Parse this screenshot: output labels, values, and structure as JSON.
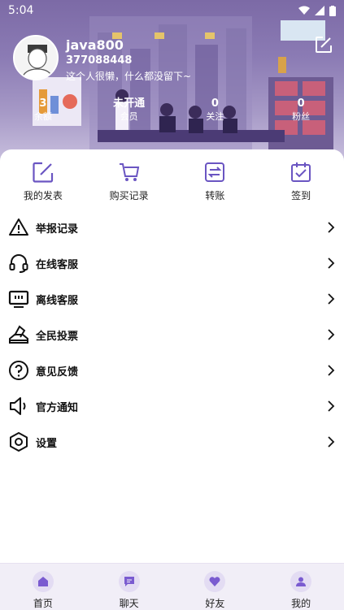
{
  "statusbar": {
    "time": "5:04"
  },
  "profile": {
    "name": "java800",
    "id": "377088448",
    "bio": "这个人很懒，什么都没留下~"
  },
  "stats": [
    {
      "value": "3",
      "label": "余额"
    },
    {
      "value": "未开通",
      "label": "会员"
    },
    {
      "value": "0",
      "label": "关注"
    },
    {
      "value": "0",
      "label": "粉丝"
    }
  ],
  "quick_actions": [
    {
      "label": "我的发表",
      "icon": "edit-square-icon"
    },
    {
      "label": "购买记录",
      "icon": "cart-icon"
    },
    {
      "label": "转账",
      "icon": "transfer-icon"
    },
    {
      "label": "签到",
      "icon": "checkin-icon"
    }
  ],
  "menu": [
    {
      "label": "举报记录",
      "icon": "warning-icon"
    },
    {
      "label": "在线客服",
      "icon": "headset-icon"
    },
    {
      "label": "离线客服",
      "icon": "monitor-icon"
    },
    {
      "label": "全民投票",
      "icon": "vote-icon"
    },
    {
      "label": "意见反馈",
      "icon": "question-icon"
    },
    {
      "label": "官方通知",
      "icon": "speaker-icon"
    },
    {
      "label": "设置",
      "icon": "settings-icon"
    }
  ],
  "tabs": [
    {
      "label": "首页",
      "icon": "home-icon"
    },
    {
      "label": "聊天",
      "icon": "chat-icon"
    },
    {
      "label": "好友",
      "icon": "heart-icon"
    },
    {
      "label": "我的",
      "icon": "user-icon"
    }
  ],
  "colors": {
    "accent": "#6a55c2",
    "header_bg": "#8b7bb4",
    "tabbar_bg": "#f1eef7"
  }
}
